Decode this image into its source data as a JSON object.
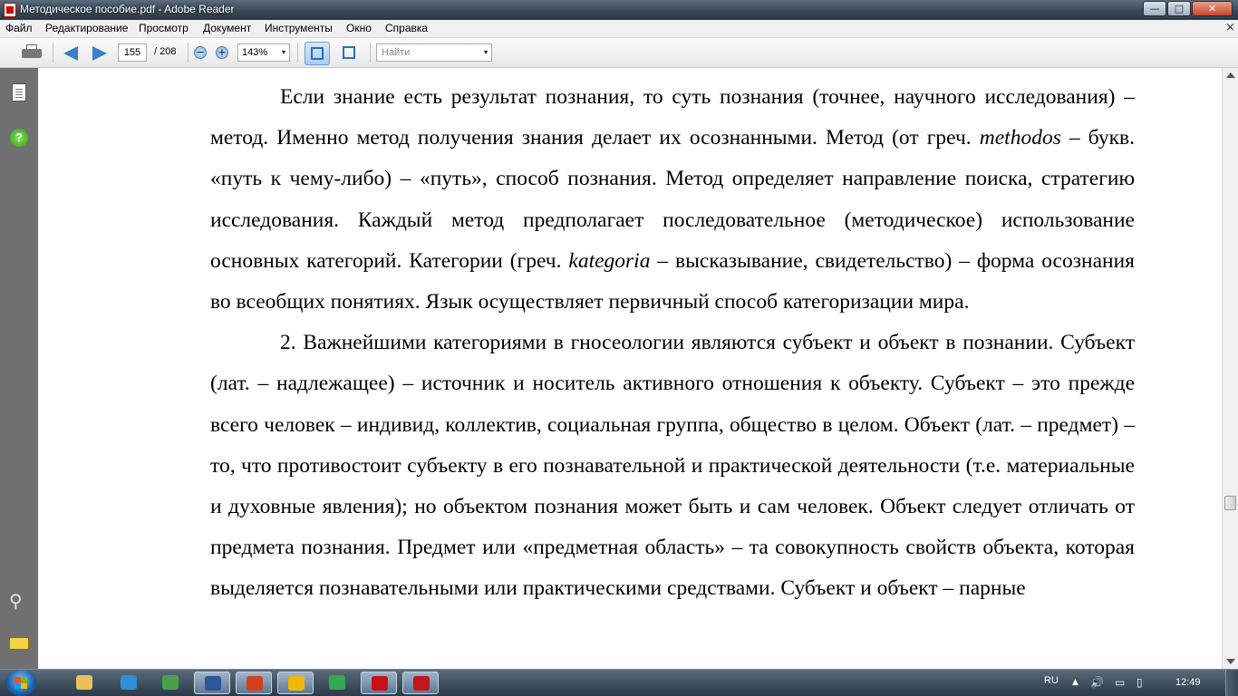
{
  "window": {
    "title": "Методическое пособие.pdf - Adobe Reader",
    "min_label": "—",
    "max_label": "□",
    "close_label": "✕"
  },
  "menu": [
    "Файл",
    "Редактирование",
    "Просмотр",
    "Документ",
    "Инструменты",
    "Окно",
    "Справка"
  ],
  "menu_close": "×",
  "toolbar": {
    "page_current": "155",
    "page_total": "/ 208",
    "zoom": "143%",
    "zoom_out_label": "−",
    "zoom_in_label": "+",
    "search_placeholder": "Найти",
    "dropdown_glyph": "▾"
  },
  "nav_icons": [
    "pages-icon",
    "help-icon",
    "paperclip-icon",
    "comment-icon"
  ],
  "nav": {
    "help_glyph": "?",
    "clip_glyph": "⚲"
  },
  "document": {
    "p1": {
      "a": "Если знание есть результат познания, то суть познания (точнее, научного исследования) – метод. Именно метод получения знания делает их осознанными. Метод (от греч. ",
      "b": "methodos",
      "c": " – букв. «путь к чему-либо) – «путь», способ познания. Метод определяет направление поиска, стратегию исследования. Каждый метод предполагает последовательное (методическое) использование основных категорий. Категории (греч. ",
      "d": "kategoria",
      "e": " – высказывание, свидетельство) – форма осознания во всеобщих понятиях. Язык осуществляет первичный способ категоризации мира."
    },
    "p2": "2. Важнейшими категориями в гносеологии являются субъект и объект в познании. Субъект (лат. – надлежащее) – источник и носитель активного отношения к объекту. Субъект – это прежде всего человек – индивид, коллектив, социальная группа, общество в целом. Объект (лат. – предмет) – то, что противостоит субъекту в его познавательной и практической деятельности (т.е. материальные и духовные явления); но объектом познания может быть и сам человек. Объект следует отличать от предмета познания. Предмет или «предметная область» – та совокупность свойств объекта, которая выделяется познавательными или практическими средствами. Субъект и объект – парные"
  },
  "taskbar": {
    "apps": [
      "explorer-icon",
      "internet-explorer-icon",
      "photo-viewer-icon",
      "word-icon",
      "presentation-icon",
      "media-player-icon",
      "chrome-icon",
      "opera-icon",
      "adobe-reader-icon"
    ],
    "app_colors": [
      "#e8c15a",
      "#2f8fd8",
      "#4aa04a",
      "#2b5797",
      "#d2401e",
      "#f0b800",
      "#34a853",
      "#cc0f16",
      "#c4161c"
    ],
    "language": "RU",
    "tray_up": "▲",
    "tray_glyphs": [
      "🔊",
      "▭",
      "▯"
    ],
    "time": "12:49"
  }
}
